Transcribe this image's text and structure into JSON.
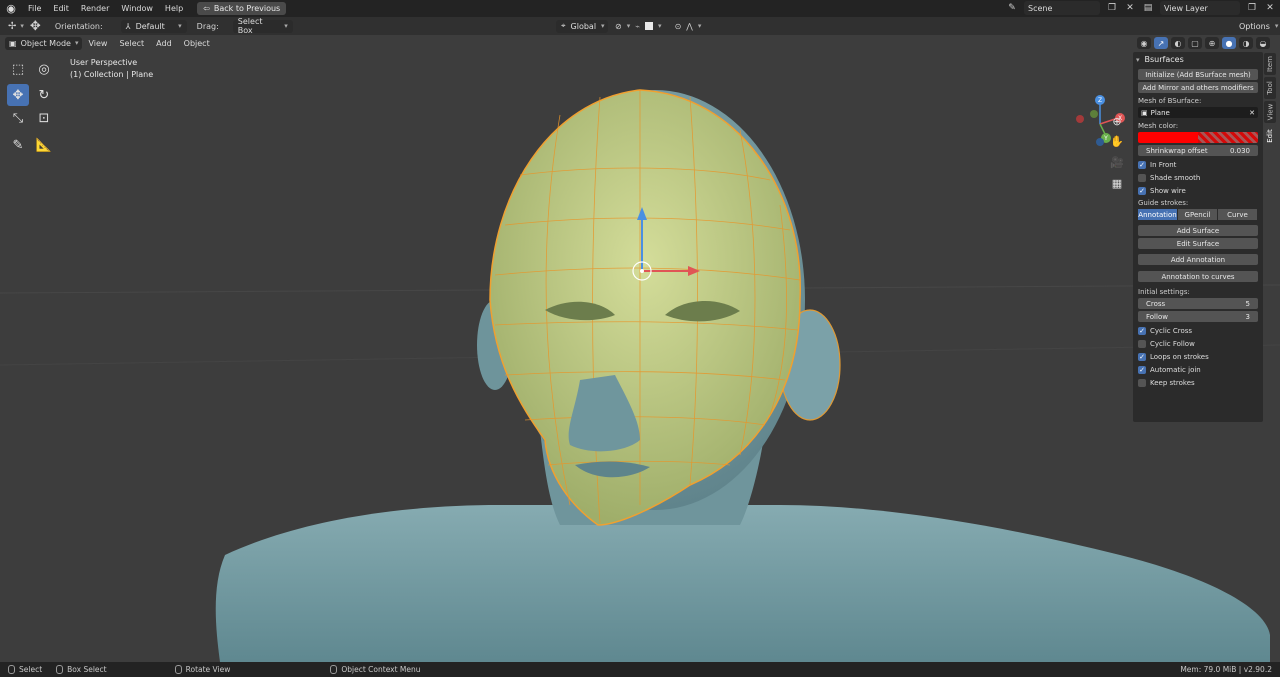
{
  "menubar": {
    "items": [
      "File",
      "Edit",
      "Render",
      "Window",
      "Help"
    ],
    "back_button": "Back to Previous",
    "scene_name": "Scene",
    "view_layer": "View Layer"
  },
  "tool_header": {
    "orientation_label": "Orientation:",
    "orientation_value": "Default",
    "drag_label": "Drag:",
    "drag_value": "Select Box",
    "transform_orientation": "Global",
    "options_label": "Options"
  },
  "viewport_header": {
    "mode": "Object Mode",
    "menus": [
      "View",
      "Select",
      "Add",
      "Object"
    ]
  },
  "viewport": {
    "perspective": "User Perspective",
    "collection": "(1) Collection | Plane"
  },
  "side_tabs": [
    "Item",
    "Tool",
    "View",
    "Edit"
  ],
  "panel": {
    "title": "Bsurfaces",
    "btn_initialize": "Initialize (Add BSurface mesh)",
    "btn_mirror": "Add Mirror and others modifiers",
    "mesh_label": "Mesh of BSurface:",
    "mesh_value": "Plane",
    "color_label": "Mesh color:",
    "mesh_color": "#ff0000",
    "shrinkwrap_label": "Shrinkwrap offset",
    "shrinkwrap_value": "0.030",
    "check_in_front": "In Front",
    "check_shade_smooth": "Shade smooth",
    "check_show_wire": "Show wire",
    "guide_label": "Guide strokes:",
    "guide_options": [
      "Annotation",
      "GPencil",
      "Curve"
    ],
    "btn_add_surface": "Add Surface",
    "btn_edit_surface": "Edit Surface",
    "btn_add_annotation": "Add Annotation",
    "btn_annotation_to_curves": "Annotation to curves",
    "initial_label": "Initial settings:",
    "cross_label": "Cross",
    "cross_value": "5",
    "follow_label": "Follow",
    "follow_value": "3",
    "check_cyclic_cross": "Cyclic Cross",
    "check_cyclic_follow": "Cyclic Follow",
    "check_loops": "Loops on strokes",
    "check_auto_join": "Automatic join",
    "check_keep_strokes": "Keep strokes"
  },
  "gizmo": {
    "x": "X",
    "y": "Y",
    "z": "Z"
  },
  "statusbar": {
    "select": "Select",
    "box_select": "Box Select",
    "rotate_view": "Rotate View",
    "context_menu": "Object Context Menu",
    "memory": "Mem: 79.0 MiB | v2.90.2"
  },
  "colors": {
    "accent": "#4772b3",
    "mesh_orange": "#f0a030",
    "skin": "#7fa6ad",
    "face_overlay": "#c8d48a"
  }
}
